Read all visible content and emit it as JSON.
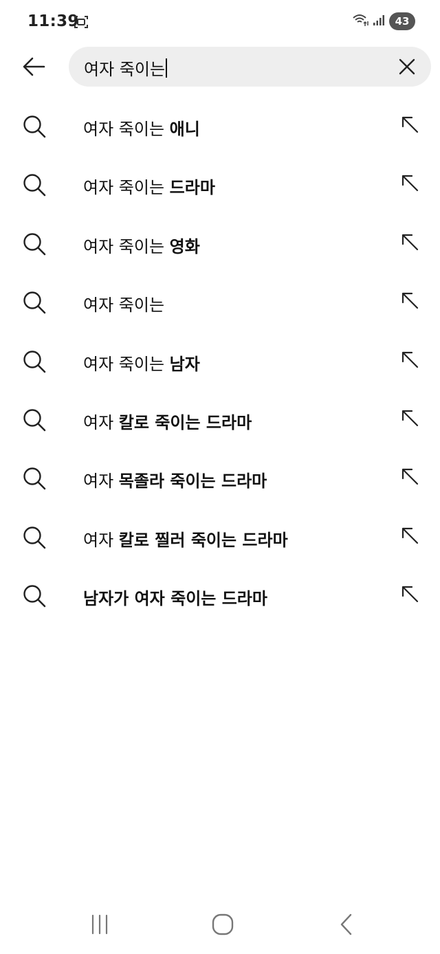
{
  "status_bar": {
    "time": "11:39",
    "battery": "43",
    "icons": [
      "screenshot-icon",
      "wifi-icon",
      "signal-icon",
      "battery-icon"
    ]
  },
  "search": {
    "query": "여자 죽이는",
    "back_icon": "arrow-left-icon",
    "clear_icon": "close-icon"
  },
  "suggestions": [
    {
      "prefix": "여자 죽이는 ",
      "suffix": "애니"
    },
    {
      "prefix": "여자 죽이는 ",
      "suffix": "드라마"
    },
    {
      "prefix": "여자 죽이는 ",
      "suffix": "영화"
    },
    {
      "prefix": "여자 죽이는",
      "suffix": ""
    },
    {
      "prefix": "여자 죽이는 ",
      "suffix": "남자"
    },
    {
      "prefix": "여자 ",
      "suffix": "칼로 죽이는 드라마"
    },
    {
      "prefix": "여자 ",
      "suffix": "목졸라 죽이는 드라마"
    },
    {
      "prefix": "여자 ",
      "suffix": "칼로 찔러 죽이는 드라마"
    },
    {
      "prefix": "",
      "suffix": "남자가 여자 죽이는 드라마"
    }
  ],
  "nav_bar": {
    "icons": [
      "recent-apps-icon",
      "home-icon",
      "back-icon"
    ]
  },
  "colors": {
    "background": "#ffffff",
    "search_box": "#eeeeee",
    "text": "#111111",
    "icon": "#222222"
  }
}
